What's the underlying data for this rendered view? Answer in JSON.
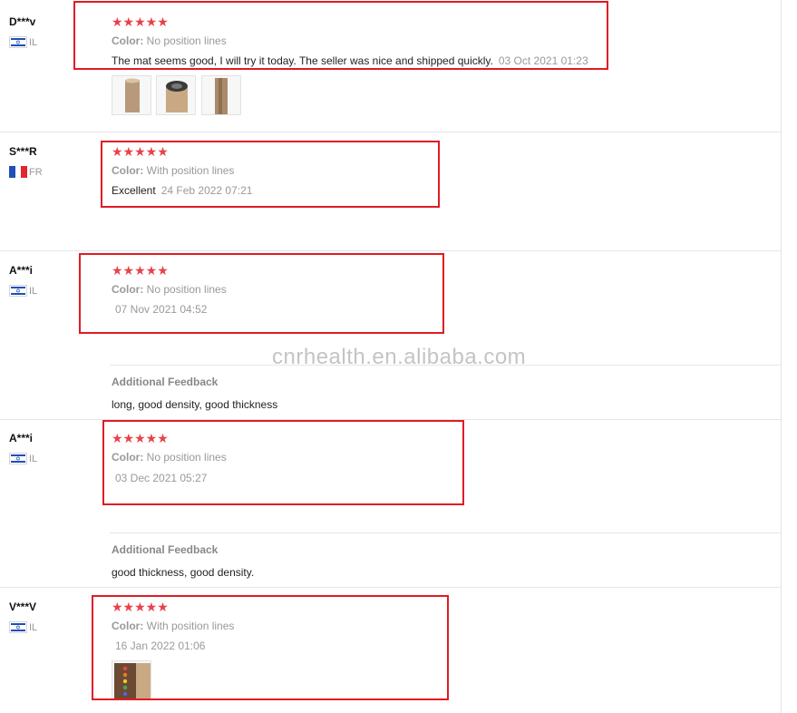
{
  "watermark": "cnrhealth.en.alibaba.com",
  "reviews": [
    {
      "user": "D***v",
      "country": "IL",
      "stars": "★★★★★",
      "attr_label": "Color:",
      "attr_value": "No position lines",
      "text": "The mat seems good, I will try it today. The seller was nice and shipped quickly.",
      "date": "03 Oct 2021 01:23",
      "photos": [
        "photo-tube-open",
        "photo-tube-end",
        "photo-mat-rolled"
      ]
    },
    {
      "user": "S***R",
      "country": "FR",
      "stars": "★★★★★",
      "attr_label": "Color:",
      "attr_value": "With position lines",
      "text": "Excellent",
      "date": "24 Feb 2022 07:21"
    },
    {
      "user": "A***i",
      "country": "IL",
      "stars": "★★★★★",
      "attr_label": "Color:",
      "attr_value": "No position lines",
      "date": "07 Nov 2021 04:52",
      "additional_label": "Additional Feedback",
      "additional_text": "long, good density, good thickness"
    },
    {
      "user": "A***i",
      "country": "IL",
      "stars": "★★★★★",
      "attr_label": "Color:",
      "attr_value": "No position lines",
      "date": "03 Dec 2021 05:27",
      "additional_label": "Additional Feedback",
      "additional_text": "good thickness, good density."
    },
    {
      "user": "V***V",
      "country": "IL",
      "stars": "★★★★★",
      "attr_label": "Color:",
      "attr_value": "With position lines",
      "date": "16 Jan 2022 01:06",
      "photos": [
        "photo-mat-markers"
      ]
    }
  ],
  "colors": {
    "star": "#e8414a",
    "highlight_box": "#e01b24",
    "muted_text": "#999999"
  }
}
